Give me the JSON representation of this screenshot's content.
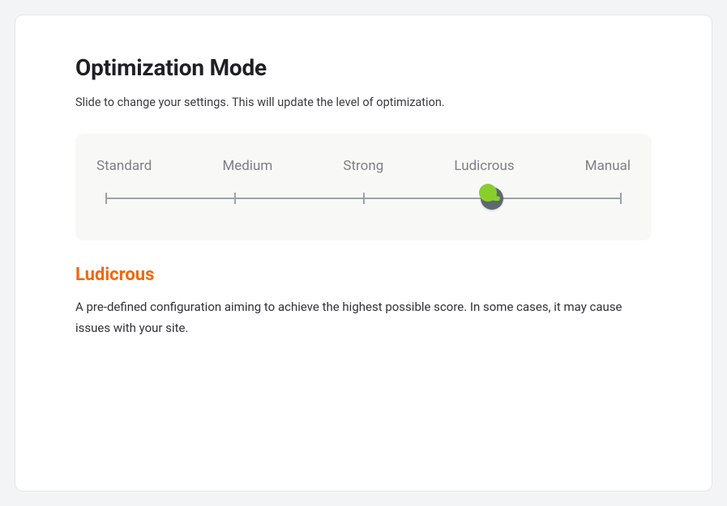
{
  "title": "Optimization Mode",
  "subtitle": "Slide to change your settings. This will update the level of optimization.",
  "slider": {
    "options": [
      "Standard",
      "Medium",
      "Strong",
      "Ludicrous",
      "Manual"
    ],
    "selected_index": 3
  },
  "selected": {
    "label": "Ludicrous",
    "description": "A pre-defined configuration aiming to achieve the highest possible score. In some cases, it may cause issues with your site."
  },
  "colors": {
    "accent_orange": "#f0680c",
    "accent_green": "#88cf2e",
    "handle_gray": "#5f6770"
  }
}
